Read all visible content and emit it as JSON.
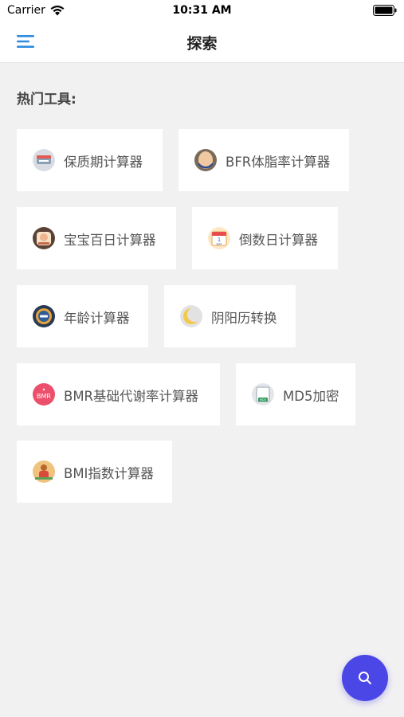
{
  "status_bar": {
    "carrier": "Carrier",
    "time": "10:31 AM"
  },
  "nav": {
    "title": "探索",
    "menu_icon": "hamburger-menu-icon"
  },
  "section": {
    "title": "热门工具:"
  },
  "tools": [
    {
      "label": "保质期计算器",
      "icon": "shelf-life-icon"
    },
    {
      "label": "BFR体脂率计算器",
      "icon": "body-fat-icon"
    },
    {
      "label": "宝宝百日计算器",
      "icon": "baby-icon"
    },
    {
      "label": "倒数日计算器",
      "icon": "calendar-icon",
      "icon_text": "1",
      "icon_subtext": "DAY"
    },
    {
      "label": "年龄计算器",
      "icon": "age-icon"
    },
    {
      "label": "阴阳历转换",
      "icon": "moon-icon"
    },
    {
      "label": "BMR基础代谢率计算器",
      "icon": "bmr-icon",
      "icon_text": "BMR"
    },
    {
      "label": "MD5加密",
      "icon": "md5-icon",
      "icon_text": "MD5"
    },
    {
      "label": "BMI指数计算器",
      "icon": "bmi-icon"
    }
  ],
  "fab": {
    "icon": "search-icon"
  },
  "colors": {
    "accent": "#4b46e6",
    "menu": "#2f8cde",
    "background": "#f1f1f2"
  }
}
